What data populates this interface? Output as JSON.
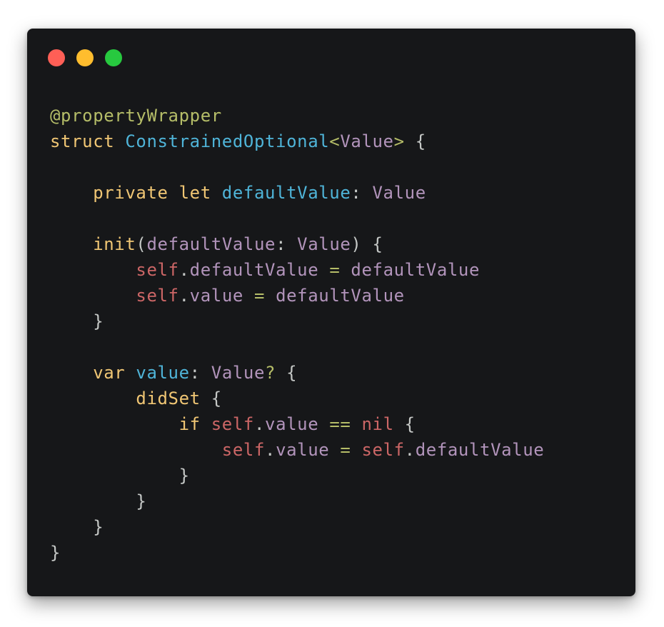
{
  "window": {
    "traffic_lights": [
      {
        "name": "close",
        "color": "#ff5f56"
      },
      {
        "name": "minimize",
        "color": "#ffbd2e"
      },
      {
        "name": "zoom",
        "color": "#27c93f"
      }
    ]
  },
  "theme": {
    "background": "#161719",
    "default": "#c5c8c6",
    "attribute": "#b5bd68",
    "keyword": "#f0c674",
    "type": "#81a2be",
    "identifier": "#4fb4d8",
    "variable": "#b294bb",
    "self": "#cc6666",
    "operator": "#b5bd68"
  },
  "code": {
    "language": "swift",
    "lines": [
      [
        [
          "attribute",
          "@propertyWrapper"
        ]
      ],
      [
        [
          "keyword",
          "struct "
        ],
        [
          "identifier",
          "ConstrainedOptional"
        ],
        [
          "attribute",
          "<"
        ],
        [
          "variable",
          "Value"
        ],
        [
          "attribute",
          ">"
        ],
        [
          "default",
          " {"
        ]
      ],
      [],
      [
        [
          "default",
          "    "
        ],
        [
          "keyword",
          "private let "
        ],
        [
          "identifier",
          "defaultValue"
        ],
        [
          "default",
          ": "
        ],
        [
          "variable",
          "Value"
        ]
      ],
      [],
      [
        [
          "default",
          "    "
        ],
        [
          "keyword",
          "init"
        ],
        [
          "default",
          "("
        ],
        [
          "variable",
          "defaultValue"
        ],
        [
          "default",
          ": "
        ],
        [
          "variable",
          "Value"
        ],
        [
          "default",
          ") {"
        ]
      ],
      [
        [
          "default",
          "        "
        ],
        [
          "self",
          "self"
        ],
        [
          "default",
          "."
        ],
        [
          "variable",
          "defaultValue"
        ],
        [
          "operator",
          " = "
        ],
        [
          "variable",
          "defaultValue"
        ]
      ],
      [
        [
          "default",
          "        "
        ],
        [
          "self",
          "self"
        ],
        [
          "default",
          "."
        ],
        [
          "variable",
          "value"
        ],
        [
          "operator",
          " = "
        ],
        [
          "variable",
          "defaultValue"
        ]
      ],
      [
        [
          "default",
          "    }"
        ]
      ],
      [],
      [
        [
          "default",
          "    "
        ],
        [
          "keyword",
          "var "
        ],
        [
          "identifier",
          "value"
        ],
        [
          "default",
          ": "
        ],
        [
          "variable",
          "Value"
        ],
        [
          "attribute",
          "?"
        ],
        [
          "default",
          " {"
        ]
      ],
      [
        [
          "default",
          "        "
        ],
        [
          "keyword",
          "didSet"
        ],
        [
          "default",
          " {"
        ]
      ],
      [
        [
          "default",
          "            "
        ],
        [
          "keyword",
          "if "
        ],
        [
          "self",
          "self"
        ],
        [
          "default",
          "."
        ],
        [
          "variable",
          "value"
        ],
        [
          "operator",
          " == "
        ],
        [
          "self",
          "nil"
        ],
        [
          "default",
          " {"
        ]
      ],
      [
        [
          "default",
          "                "
        ],
        [
          "self",
          "self"
        ],
        [
          "default",
          "."
        ],
        [
          "variable",
          "value"
        ],
        [
          "operator",
          " = "
        ],
        [
          "self",
          "self"
        ],
        [
          "default",
          "."
        ],
        [
          "variable",
          "defaultValue"
        ]
      ],
      [
        [
          "default",
          "            }"
        ]
      ],
      [
        [
          "default",
          "        }"
        ]
      ],
      [
        [
          "default",
          "    }"
        ]
      ],
      [
        [
          "default",
          "}"
        ]
      ]
    ]
  }
}
